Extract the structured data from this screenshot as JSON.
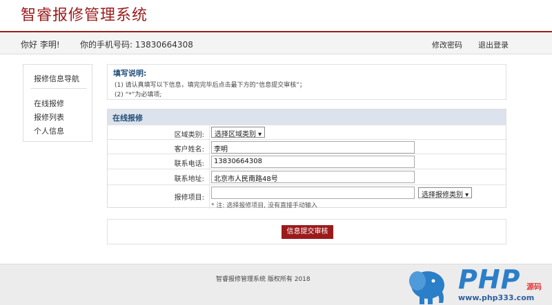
{
  "header": {
    "title": "智睿报修管理系统"
  },
  "userbar": {
    "greeting": "你好 李明!",
    "phone_label": "你的手机号码: 13830664308",
    "change_password": "修改密码",
    "logout": "退出登录"
  },
  "sidebar": {
    "title": "报修信息导航",
    "items": [
      {
        "label": "在线报修"
      },
      {
        "label": "报修列表"
      },
      {
        "label": "个人信息"
      }
    ]
  },
  "notes": {
    "title": "填写说明:",
    "lines": [
      "(1) 请认真填写以下信息，填完完毕后点击最下方的“信息提交审核”；",
      "(2) “*”为必填项;"
    ]
  },
  "form": {
    "title": "在线报修",
    "region": {
      "label": "区域类别:",
      "value": "选择区域类别 ▾"
    },
    "name": {
      "label": "客户姓名:",
      "value": "李明"
    },
    "phone": {
      "label": "联系电话:",
      "value": "13830664308"
    },
    "address": {
      "label": "联系地址:",
      "value": "北京市人民南路48号"
    },
    "item": {
      "label": "报修项目:",
      "value": "",
      "select": "选择报修类别 ▾",
      "hint": "* 注: 选择报修项目, 没有直接手动输入"
    }
  },
  "submit": {
    "label": "信息提交审核"
  },
  "footer": {
    "copyright": "智睿报修管理系统 版权所有  2018"
  },
  "watermark": {
    "brand": "PHP",
    "suffix": "源码",
    "url": "www.php333.com"
  },
  "colors": {
    "brand": "#9b1b1b",
    "heading": "#1f4e79",
    "form_header_bg": "#dde3ec",
    "watermark_blue": "#2b7ec8"
  }
}
